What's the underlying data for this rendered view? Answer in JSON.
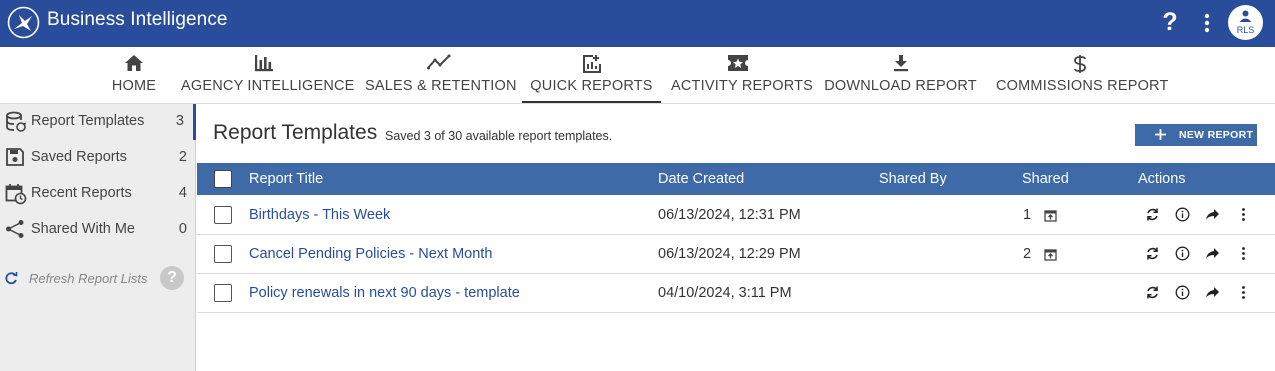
{
  "header": {
    "app_title": "Business Intelligence",
    "help_label": "?",
    "user_initials": "RLS"
  },
  "nav": {
    "tabs": [
      {
        "label": "HOME",
        "icon": "home-icon"
      },
      {
        "label": "AGENCY INTELLIGENCE",
        "icon": "bar-chart-icon"
      },
      {
        "label": "SALES & RETENTION",
        "icon": "trend-line-icon"
      },
      {
        "label": "QUICK REPORTS",
        "icon": "report-add-icon",
        "active": true
      },
      {
        "label": "ACTIVITY REPORTS",
        "icon": "ticket-star-icon"
      },
      {
        "label": "DOWNLOAD REPORT",
        "icon": "download-icon"
      },
      {
        "label": "COMMISSIONS REPORT",
        "icon": "dollar-icon"
      }
    ]
  },
  "sidebar": {
    "items": [
      {
        "label": "Report Templates",
        "count": "3",
        "icon": "database-sync-icon",
        "active": true
      },
      {
        "label": "Saved Reports",
        "count": "2",
        "icon": "floppy-disk-icon"
      },
      {
        "label": "Recent Reports",
        "count": "4",
        "icon": "calendar-clock-icon"
      },
      {
        "label": "Shared With Me",
        "count": "0",
        "icon": "share-nodes-icon"
      }
    ],
    "refresh_label": "Refresh Report Lists",
    "help_label": "?"
  },
  "main": {
    "title": "Report Templates",
    "subtitle": "Saved 3 of 30 available report templates.",
    "new_report_label": "NEW REPORT"
  },
  "table": {
    "headers": {
      "title": "Report Title",
      "date": "Date Created",
      "shared_by": "Shared By",
      "shared": "Shared",
      "actions": "Actions"
    },
    "rows": [
      {
        "title": "Birthdays - This Week",
        "date": "06/13/2024, 12:31 PM",
        "shared_by": "",
        "shared": "1"
      },
      {
        "title": "Cancel Pending Policies - Next Month",
        "date": "06/13/2024, 12:29 PM",
        "shared_by": "",
        "shared": "2"
      },
      {
        "title": "Policy renewals in next 90 days - template",
        "date": "04/10/2024, 3:11 PM",
        "shared_by": "",
        "shared": ""
      }
    ]
  },
  "colors": {
    "header_bg": "#2a4d9b",
    "table_header_bg": "#3f6aa8",
    "link": "#2a4d9b",
    "sidebar_bg": "#ededed"
  }
}
